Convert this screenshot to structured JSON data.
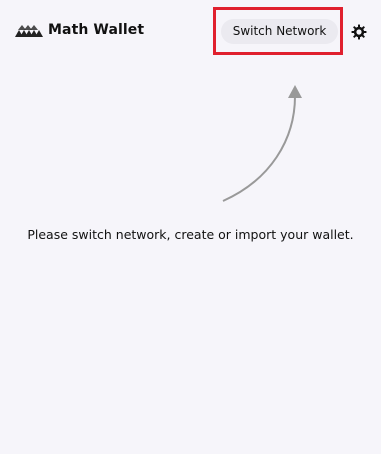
{
  "header": {
    "app_title": "Math Wallet",
    "logo_icon": "math-wallet-logo-icon",
    "switch_network_label": "Switch Network",
    "settings_icon": "gear-icon"
  },
  "main": {
    "message": "Please switch network, create or import your wallet.",
    "arrow_icon": "curved-arrow-up-icon"
  },
  "colors": {
    "background": "#f6f5fa",
    "button_bg": "#ebeaf0",
    "highlight": "#e0202e",
    "arrow": "#999999"
  }
}
